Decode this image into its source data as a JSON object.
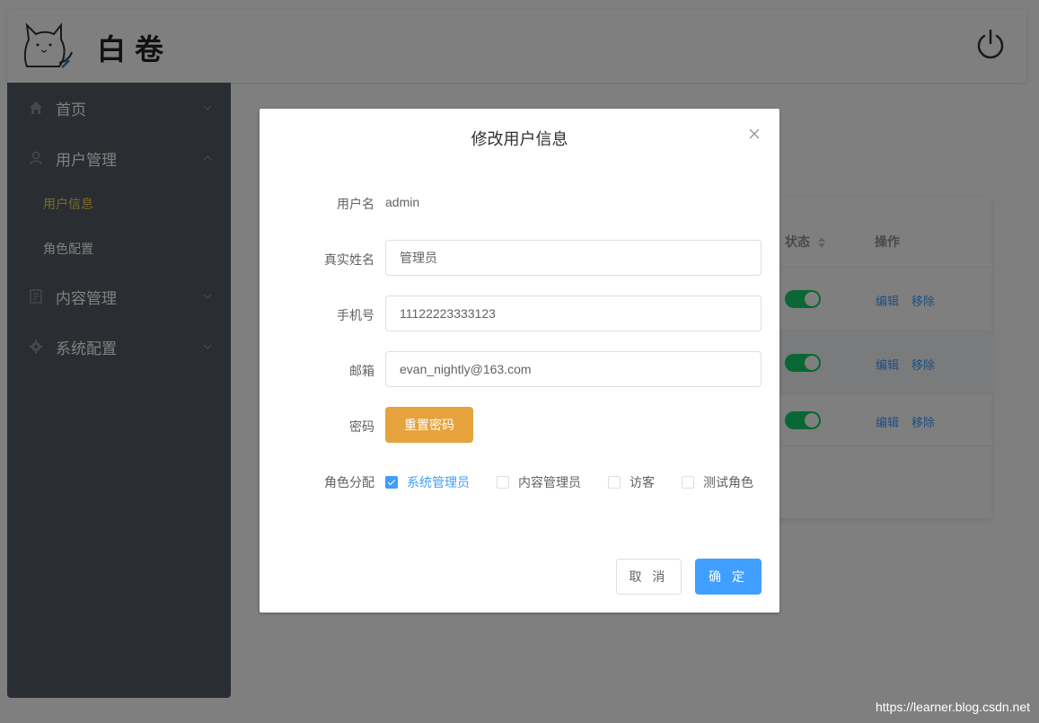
{
  "header": {
    "logo_text": "白卷"
  },
  "sidebar": {
    "items": [
      {
        "label": "首页",
        "icon": "home-icon"
      },
      {
        "label": "用户管理",
        "icon": "user-icon",
        "children": [
          {
            "label": "用户信息",
            "active": true
          },
          {
            "label": "角色配置",
            "active": false
          }
        ]
      },
      {
        "label": "内容管理",
        "icon": "document-icon"
      },
      {
        "label": "系统配置",
        "icon": "gear-icon"
      }
    ]
  },
  "table": {
    "headers": {
      "status": "状态",
      "actions": "操作"
    },
    "rows": [
      {
        "status_on": true,
        "edit": "编辑",
        "remove": "移除"
      },
      {
        "status_on": true,
        "edit": "编辑",
        "remove": "移除"
      },
      {
        "status_on": true,
        "edit": "编辑",
        "remove": "移除"
      }
    ]
  },
  "dialog": {
    "title": "修改用户信息",
    "fields": {
      "username_label": "用户名",
      "username_value": "admin",
      "realname_label": "真实姓名",
      "realname_value": "管理员",
      "phone_label": "手机号",
      "phone_value": "11122223333123",
      "email_label": "邮箱",
      "email_value": "evan_nightly@163.com",
      "password_label": "密码",
      "reset_button": "重置密码",
      "roles_label": "角色分配"
    },
    "roles": [
      {
        "label": "系统管理员",
        "checked": true
      },
      {
        "label": "内容管理员",
        "checked": false
      },
      {
        "label": "访客",
        "checked": false
      },
      {
        "label": "测试角色",
        "checked": false
      }
    ],
    "cancel_label": "取 消",
    "ok_label": "确 定"
  },
  "watermark": "https://learner.blog.csdn.net",
  "colors": {
    "primary": "#409eff",
    "warning": "#e6a23c",
    "success_switch": "#13ce66",
    "sidebar_bg": "#545c64",
    "menu_active": "#ffd04b"
  }
}
